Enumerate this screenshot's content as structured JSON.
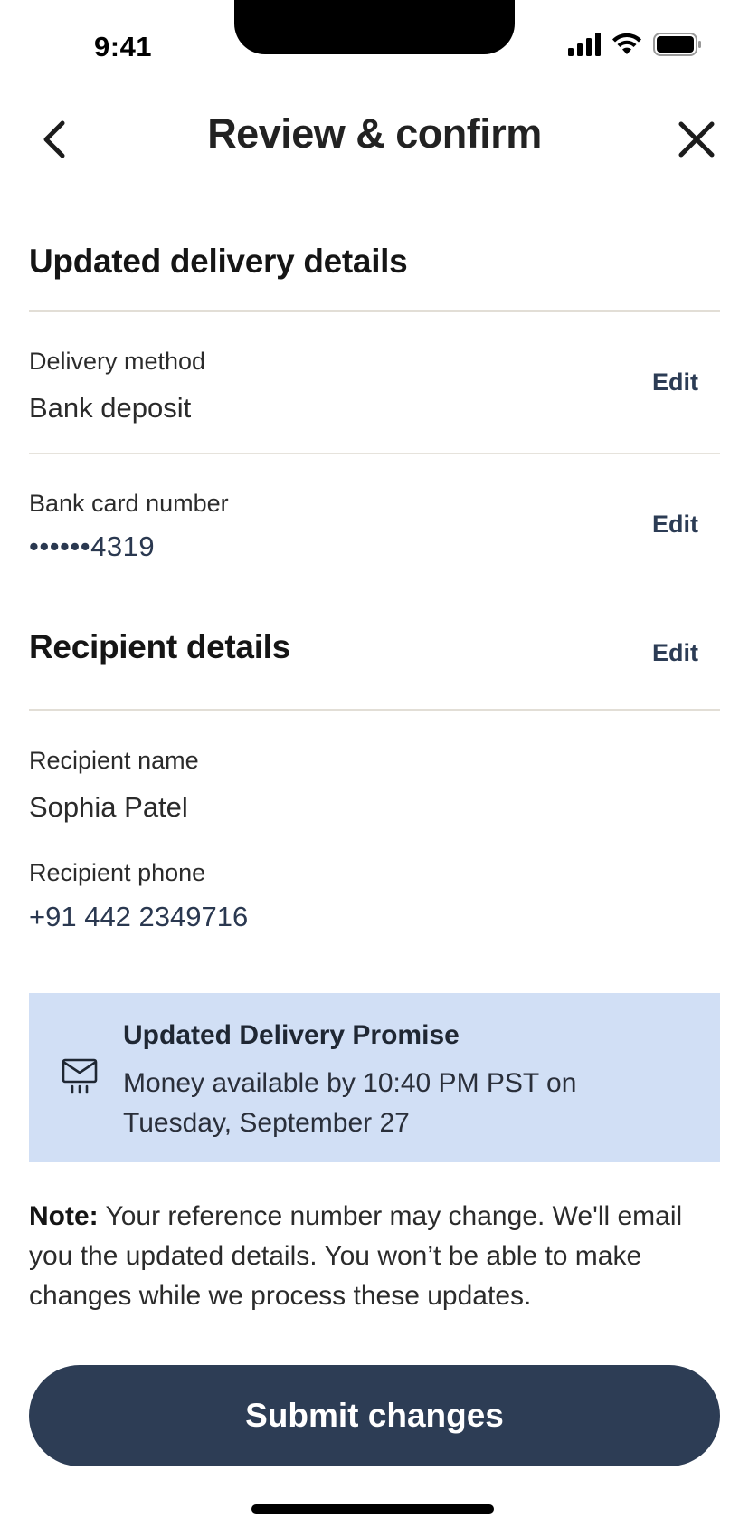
{
  "status_bar": {
    "time": "9:41"
  },
  "header": {
    "title": "Review & confirm",
    "back_icon": "chevron-left-icon",
    "close_icon": "close-icon"
  },
  "delivery_section": {
    "heading": "Updated delivery details",
    "fields": [
      {
        "label": "Delivery method",
        "value": "Bank deposit",
        "edit_label": "Edit"
      },
      {
        "label": "Bank card number",
        "value": "••••••4319",
        "edit_label": "Edit"
      }
    ]
  },
  "recipient_section": {
    "heading": "Recipient details",
    "edit_label": "Edit",
    "fields": [
      {
        "label": "Recipient name",
        "value": "Sophia Patel"
      },
      {
        "label": "Recipient phone",
        "value": "+91 442 2349716"
      }
    ]
  },
  "promise": {
    "icon": "envelope-icon",
    "title": "Updated Delivery Promise",
    "text": "Money available by 10:40 PM PST on Tuesday, September 27",
    "background": "#d1dff5"
  },
  "note": {
    "bold": "Note:",
    "text": " Your reference number may change. We'll email you the updated details. You won’t be able to make changes while we process these updates."
  },
  "submit": {
    "label": "Submit changes",
    "color": "#2d3d55"
  }
}
